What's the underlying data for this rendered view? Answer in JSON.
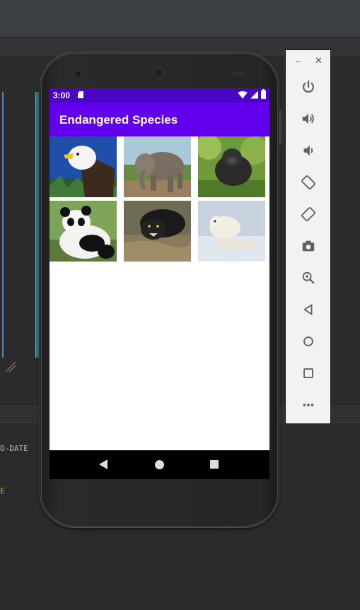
{
  "ide": {
    "build_lines": [
      {
        "text": "O-DATE",
        "style": "normal"
      },
      {
        "text": "E",
        "style": "warn"
      }
    ],
    "colors": {
      "background": "#2b2b2b",
      "toolbar": "#3c3f41"
    }
  },
  "phone": {
    "status_bar": {
      "time": "3:00",
      "icons": [
        "sd-card-icon",
        "wifi-icon",
        "signal-icon",
        "battery-icon"
      ]
    },
    "app_bar": {
      "title": "Endangered Species",
      "color": "#6200ee"
    },
    "grid_images": [
      {
        "name": "bald-eagle-image",
        "subject": "bald eagle"
      },
      {
        "name": "elephant-image",
        "subject": "elephant"
      },
      {
        "name": "gorilla-image",
        "subject": "gorilla"
      },
      {
        "name": "panda-image",
        "subject": "giant panda"
      },
      {
        "name": "black-panther-image",
        "subject": "black panther"
      },
      {
        "name": "polar-bear-image",
        "subject": "polar bears"
      }
    ],
    "nav_bar": {
      "buttons": [
        "back-icon",
        "home-icon",
        "recents-icon"
      ]
    }
  },
  "emulator_panel": {
    "window_controls": {
      "minimize": "–",
      "close": "✕"
    },
    "buttons": [
      "power-icon",
      "volume-up-icon",
      "volume-down-icon",
      "rotate-left-icon",
      "rotate-right-icon",
      "camera-icon",
      "zoom-icon",
      "back-icon",
      "home-icon",
      "overview-icon",
      "more-icon"
    ]
  }
}
